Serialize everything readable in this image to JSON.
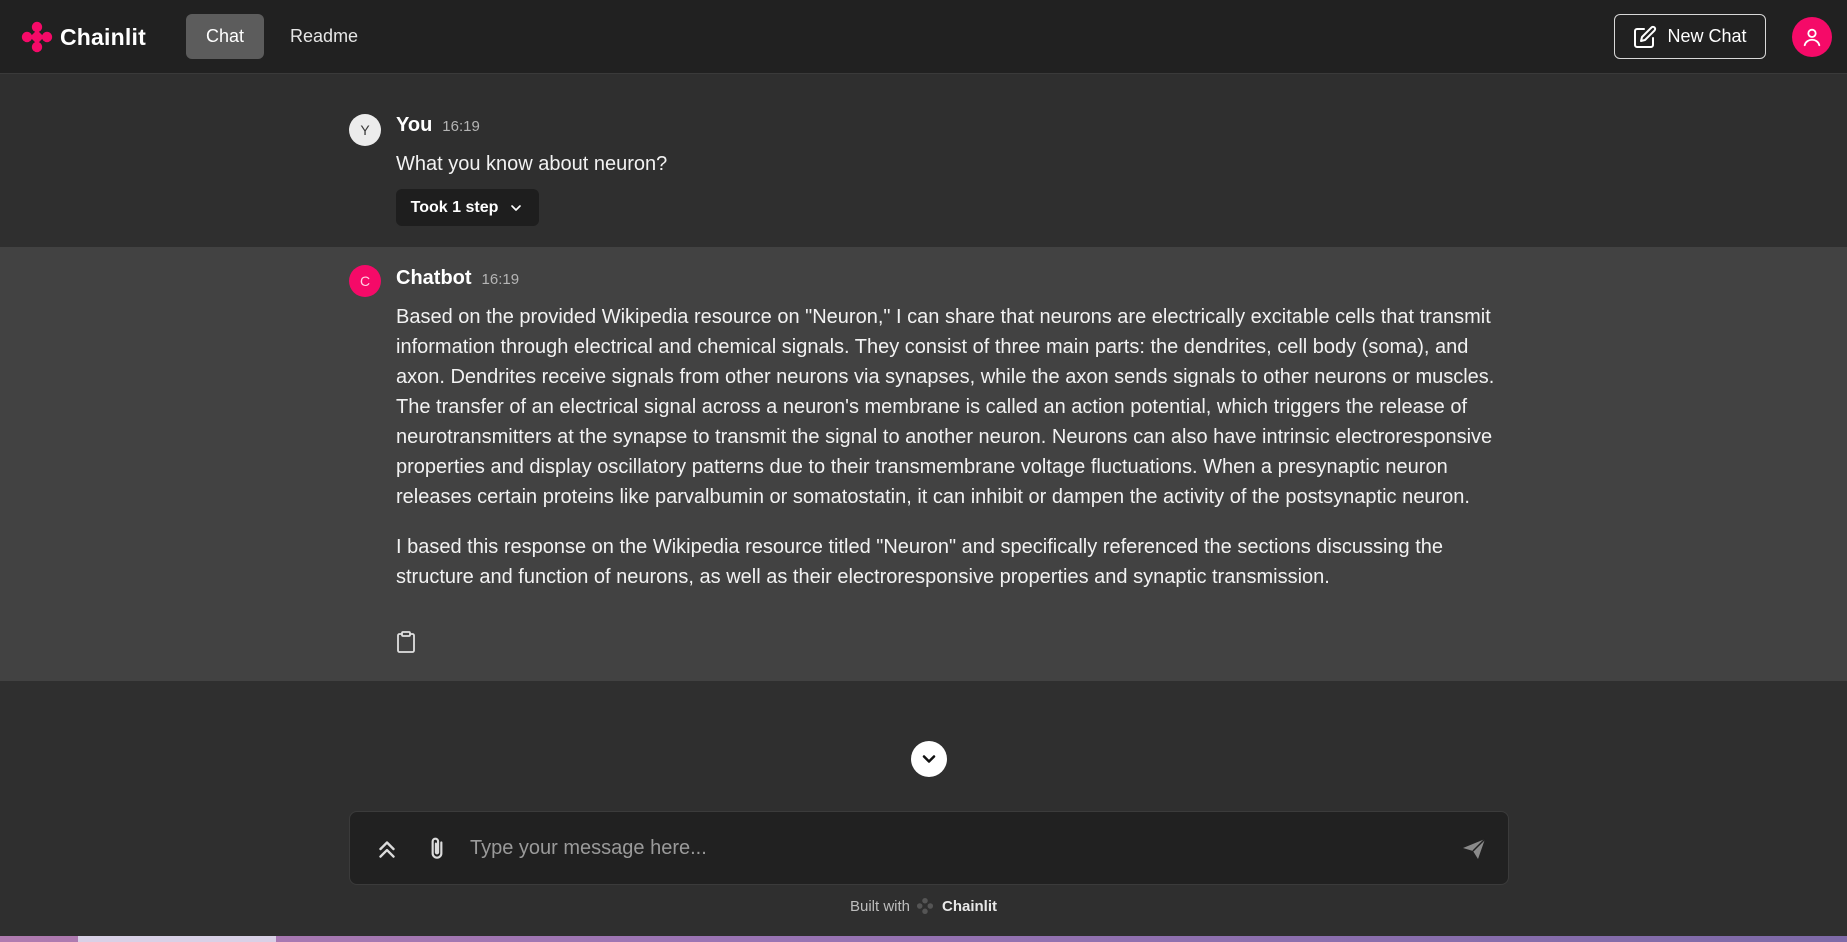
{
  "header": {
    "brand": "Chainlit",
    "tabs": [
      {
        "label": "Chat",
        "active": true
      },
      {
        "label": "Readme",
        "active": false
      }
    ],
    "new_chat_label": "New Chat"
  },
  "messages": [
    {
      "author": "You",
      "avatar_letter": "Y",
      "time": "16:19",
      "text": "What you know about neuron?",
      "steps_label": "Took 1 step"
    },
    {
      "author": "Chatbot",
      "avatar_letter": "C",
      "time": "16:19",
      "paragraphs": [
        "Based on the provided Wikipedia resource on \"Neuron,\" I can share that neurons are electrically excitable cells that transmit information through electrical and chemical signals. They consist of three main parts: the dendrites, cell body (soma), and axon. Dendrites receive signals from other neurons via synapses, while the axon sends signals to other neurons or muscles. The transfer of an electrical signal across a neuron's membrane is called an action potential, which triggers the release of neurotransmitters at the synapse to transmit the signal to another neuron. Neurons can also have intrinsic electroresponsive properties and display oscillatory patterns due to their transmembrane voltage fluctuations. When a presynaptic neuron releases certain proteins like parvalbumin or somatostatin, it can inhibit or dampen the activity of the postsynaptic neuron.",
        "I based this response on the Wikipedia resource titled \"Neuron\" and specifically referenced the sections discussing the structure and function of neurons, as well as their electroresponsive properties and synaptic transmission."
      ]
    }
  ],
  "composer": {
    "placeholder": "Type your message here...",
    "value": ""
  },
  "footer": {
    "built_with": "Built with",
    "brand": "Chainlit"
  },
  "icons": {
    "logo": "chainlit-logo-icon",
    "new_chat": "edit-icon",
    "user": "user-icon",
    "step_toggle": "chevron-down-icon",
    "copy": "clipboard-icon",
    "scroll": "chevron-down-icon",
    "expand": "chevrons-up-icon",
    "attach": "paperclip-icon",
    "send": "send-icon"
  },
  "colors": {
    "accent": "#f50a68",
    "header_bg": "#212121",
    "page_bg": "#2f2f2f",
    "bot_row_bg": "#424242"
  }
}
